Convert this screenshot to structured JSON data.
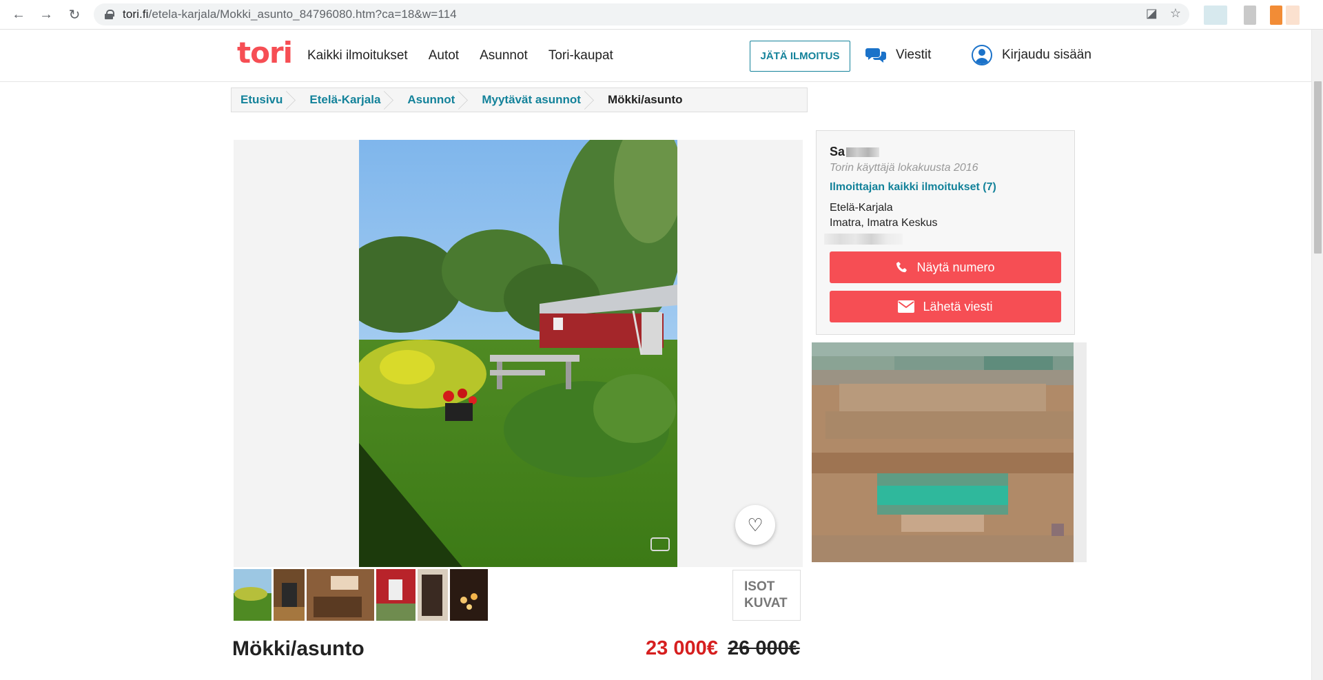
{
  "browser": {
    "url_host": "tori.fi",
    "url_path": "/etela-karjala/Mokki_asunto_84796080.htm?ca=18&w=114",
    "icons": [
      "back-icon",
      "forward-icon",
      "reload-icon",
      "lock-icon",
      "translate-icon",
      "star-icon"
    ]
  },
  "header": {
    "logo": "tori",
    "nav": [
      "Kaikki ilmoitukset",
      "Autot",
      "Asunnot",
      "Tori-kaupat"
    ],
    "cta": "JÄTÄ ILMOITUS",
    "messages": "Viestit",
    "login": "Kirjaudu sisään"
  },
  "breadcrumb": [
    "Etusivu",
    "Etelä-Karjala",
    "Asunnot",
    "Myytävät asunnot",
    "Mökki/asunto"
  ],
  "gallery": {
    "big_pictures": [
      "ISOT",
      "KUVAT"
    ],
    "thumbnail_count": 6
  },
  "listing": {
    "title": "Mökki/asunto",
    "price": "23 000€",
    "old_price": "26 000€"
  },
  "seller": {
    "name_prefix": "Sa",
    "since": "Torin käyttäjä lokakuusta 2016",
    "all_ads": "Ilmoittajan kaikki ilmoitukset (7)",
    "region": "Etelä-Karjala",
    "city": "Imatra, Imatra Keskus",
    "show_number": "Näytä numero",
    "send_message": "Lähetä viesti"
  },
  "colors": {
    "brand": "#f64e54",
    "link": "#13829a",
    "price": "#d61f1f"
  }
}
